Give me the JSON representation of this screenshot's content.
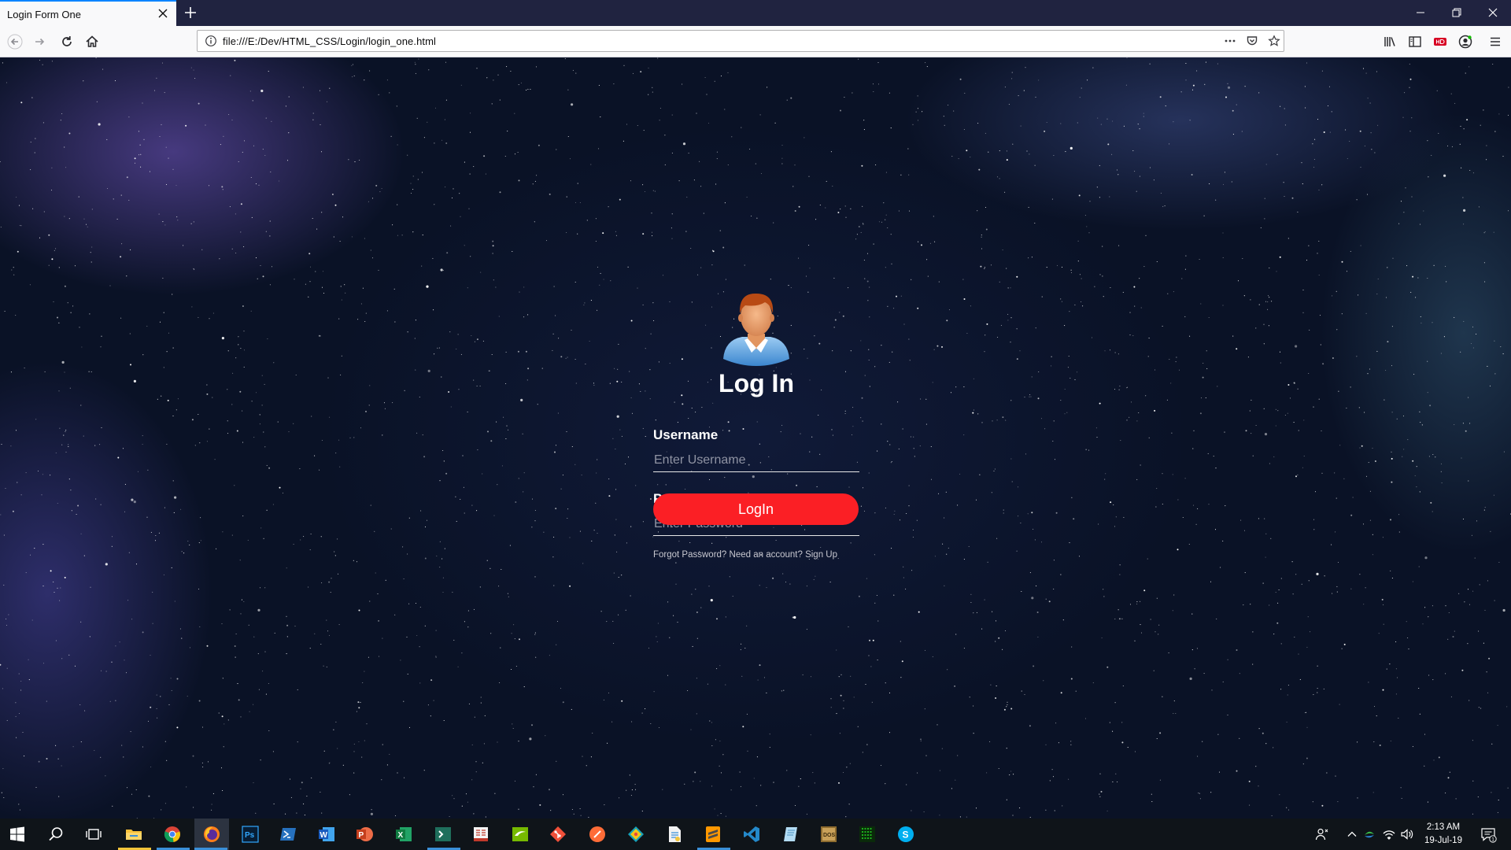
{
  "browser": {
    "tab_title": "Login Form One",
    "url": "file:///E:/Dev/HTML_CSS/Login/login_one.html"
  },
  "page": {
    "title": "Log In",
    "username": {
      "label": "Username",
      "placeholder": "Enter Username",
      "value": ""
    },
    "password": {
      "label": "Password",
      "placeholder": "Enter Password",
      "value": ""
    },
    "login_button": "LogIn",
    "forgot_link": "Forgot Password?",
    "signup_link": "Need an account? Sign Up",
    "button_color": "#fb1f25"
  },
  "taskbar": {
    "apps": [
      "start-icon",
      "search-icon",
      "task-view-icon",
      "file-explorer-icon",
      "chrome-icon",
      "firefox-icon",
      "photoshop-icon",
      "powershell-icon",
      "word-icon",
      "powerpoint-icon",
      "excel-icon",
      "terminal-icon",
      "reader-icon",
      "nvidia-icon",
      "git-icon",
      "postman-icon",
      "gitkraken-icon",
      "document-icon",
      "sublime-icon",
      "vscode-icon",
      "notepad-icon",
      "archive-icon",
      "matrix-icon",
      "skype-icon"
    ],
    "time": "2:13 AM",
    "date": "19-Jul-19",
    "notification_count": "1"
  }
}
